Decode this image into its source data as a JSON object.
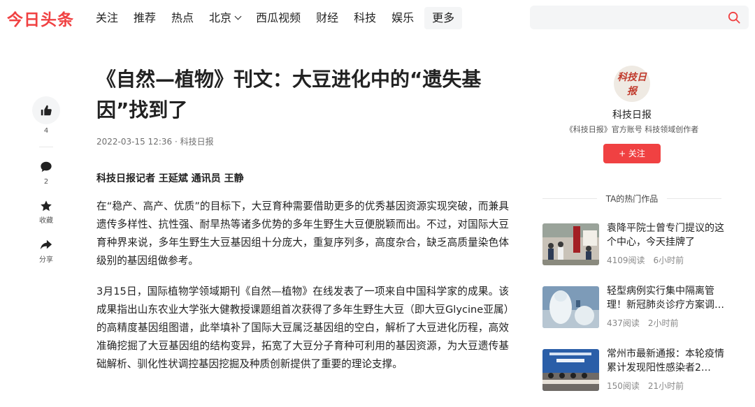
{
  "header": {
    "logo": "今日头条",
    "nav": [
      "关注",
      "推荐",
      "热点",
      "北京",
      "西瓜视频",
      "财经",
      "科技",
      "娱乐"
    ],
    "more": "更多",
    "search_placeholder": ""
  },
  "actions": {
    "like_count": "4",
    "comment_count": "2",
    "collect_label": "收藏",
    "share_label": "分享"
  },
  "article": {
    "title": "《自然—植物》刊文：大豆进化中的“遗失基因”找到了",
    "meta": "2022-03-15 12:36 · 科技日报",
    "byline": "科技日报记者 王延斌 通讯员 王静",
    "paragraphs": [
      "在“稳产、高产、优质”的目标下，大豆育种需要借助更多的优秀基因资源实现突破，而兼具遗传多样性、抗性强、耐旱热等诸多优势的多年生野生大豆便脱颖而出。不过，对国际大豆育种界来说，多年生野生大豆基因组十分庞大，重复序列多，高度杂合，缺乏高质量染色体级别的基因组做参考。",
      "3月15日，国际植物学领域期刊《自然—植物》在线发表了一项来自中国科学家的成果。该成果指出山东农业大学张大健教授课题组首次获得了多年生野生大豆（即大豆Glycine亚属）的高精度基因组图谱，此举填补了国际大豆属泛基因组的空白，解析了大豆进化历程，高效准确挖掘了大豆基因组的结构变异，拓宽了大豆分子育种可利用的基因资源，为大豆遗传基础解析、驯化性状调控基因挖掘及种质创新提供了重要的理论支撑。"
    ]
  },
  "author": {
    "avatar_text": "科技日报",
    "name": "科技日报",
    "desc": "《科技日报》官方账号 科技领域创作者",
    "follow_label": "+ 关注"
  },
  "hot": {
    "title": "TA的热门作品",
    "items": [
      {
        "title": "袁降平院士曾专门提议的这个中心，今天挂牌了",
        "reads": "4109阅读",
        "time": "6小时前"
      },
      {
        "title": "轻型病例实行集中隔离管理！新冠肺炎诊疗方案调…",
        "reads": "437阅读",
        "time": "2小时前"
      },
      {
        "title": "常州市最新通报：本轮疫情累计发现阳性感染者2…",
        "reads": "150阅读",
        "time": "21小时前"
      }
    ]
  },
  "colors": {
    "brand": "#f04142",
    "text": "#222222",
    "meta": "#888888"
  }
}
